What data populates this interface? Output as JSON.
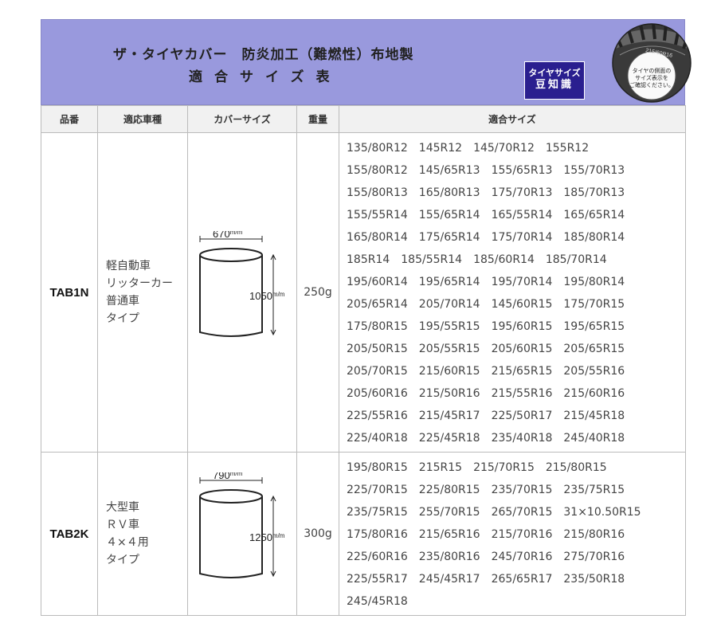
{
  "header": {
    "title_line1": "ザ・タイヤカバー　防炎加工（難燃性）布地製",
    "title_line2": "適合サイズ表",
    "badge_line1": "タイヤサイズ",
    "badge_line2": "豆知識",
    "tire_note_lines": [
      "タイヤの側面の",
      "サイズ表示を",
      "ご確認ください。"
    ],
    "tire_sidewall_text": "215/60R16",
    "colors": {
      "banner": "#9999dd",
      "badge": "#2a1f8f",
      "header_cell": "#f1f1f1"
    }
  },
  "table": {
    "headers": {
      "code": "品番",
      "vehicle": "適応車種",
      "cover": "カバーサイズ",
      "weight": "重量",
      "sizes": "適合サイズ"
    },
    "rows": [
      {
        "code": "TAB1N",
        "vehicle": [
          "軽自動車",
          "リッターカー",
          "普通車",
          "タイプ"
        ],
        "cover": {
          "diameter": "670",
          "height": "1050",
          "unit": "m/m"
        },
        "weight": "250g",
        "sizes": [
          [
            "135/80R12",
            "145R12",
            "145/70R12",
            "155R12"
          ],
          [
            "155/80R12",
            "145/65R13",
            "155/65R13",
            "155/70R13"
          ],
          [
            "155/80R13",
            "165/80R13",
            "175/70R13",
            "185/70R13"
          ],
          [
            "155/55R14",
            "155/65R14",
            "165/55R14",
            "165/65R14"
          ],
          [
            "165/80R14",
            "175/65R14",
            "175/70R14",
            "185/80R14"
          ],
          [
            "185R14",
            "185/55R14",
            "185/60R14",
            "185/70R14"
          ],
          [
            "195/60R14",
            "195/65R14",
            "195/70R14",
            "195/80R14"
          ],
          [
            "205/65R14",
            "205/70R14",
            "145/60R15",
            "175/70R15"
          ],
          [
            "175/80R15",
            "195/55R15",
            "195/60R15",
            "195/65R15"
          ],
          [
            "205/50R15",
            "205/55R15",
            "205/60R15",
            "205/65R15"
          ],
          [
            "205/70R15",
            "215/60R15",
            "215/65R15",
            "205/55R16"
          ],
          [
            "205/60R16",
            "215/50R16",
            "215/55R16",
            "215/60R16"
          ],
          [
            "225/55R16",
            "215/45R17",
            "225/50R17",
            "215/45R18"
          ],
          [
            "225/40R18",
            "225/45R18",
            "235/40R18",
            "245/40R18"
          ]
        ]
      },
      {
        "code": "TAB2K",
        "vehicle": [
          "大型車",
          "ＲＶ車",
          "４×４用",
          "タイプ"
        ],
        "cover": {
          "diameter": "790",
          "height": "1250",
          "unit": "m/m"
        },
        "weight": "300g",
        "sizes": [
          [
            "195/80R15",
            "215R15",
            "215/70R15",
            "215/80R15"
          ],
          [
            "225/70R15",
            "225/80R15",
            "235/70R15",
            "235/75R15"
          ],
          [
            "235/75R15",
            "255/70R15",
            "265/70R15",
            "31×10.50R15"
          ],
          [
            "175/80R16",
            "215/65R16",
            "215/70R16",
            "215/80R16"
          ],
          [
            "225/60R16",
            "235/80R16",
            "245/70R16",
            "275/70R16"
          ],
          [
            "225/55R17",
            "245/45R17",
            "265/65R17",
            "235/50R18"
          ],
          [
            "245/45R18"
          ]
        ]
      }
    ]
  }
}
